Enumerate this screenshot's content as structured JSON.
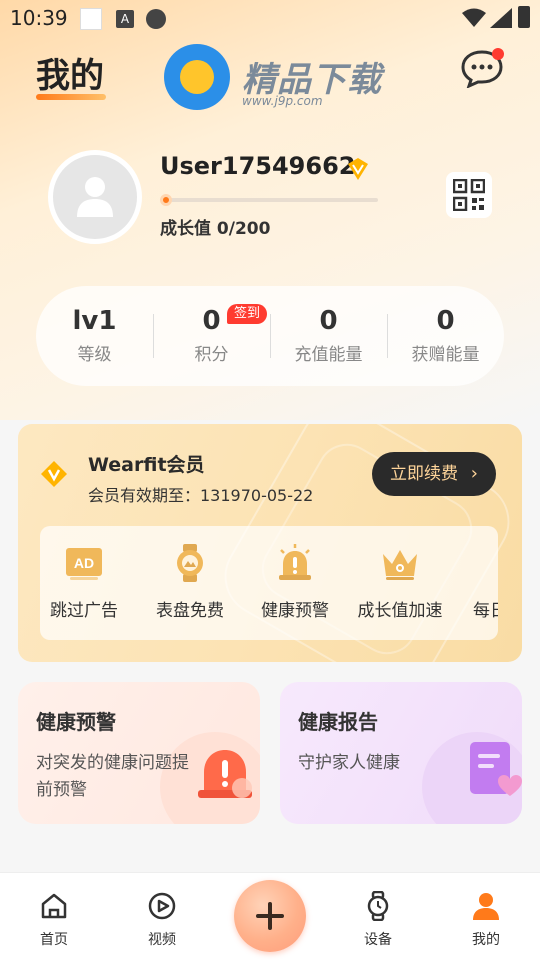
{
  "status_bar": {
    "time": "10:39",
    "a_icon": "A"
  },
  "header": {
    "title": "我的",
    "logo_text": "精品下载",
    "logo_url": "www.j9p.com"
  },
  "profile": {
    "username": "User17549662",
    "growth_label": "成长值 0/200",
    "growth_progress": 0
  },
  "stats": [
    {
      "value": "lv1",
      "label": "等级"
    },
    {
      "value": "0",
      "label": "积分"
    },
    {
      "value": "0",
      "label": "充值能量"
    },
    {
      "value": "0",
      "label": "获赠能量"
    }
  ],
  "signin_badge": "签到",
  "member": {
    "title": "Wearfit会员",
    "expiry": "会员有效期至：131970-05-22",
    "renew_label": "立即续费",
    "renew_arrow": "›",
    "benefits": [
      {
        "label": "跳过广告",
        "icon": "ad-icon",
        "icon_text": "AD"
      },
      {
        "label": "表盘免费",
        "icon": "watch-face-icon"
      },
      {
        "label": "健康预警",
        "icon": "alarm-icon"
      },
      {
        "label": "成长值加速",
        "icon": "crown-icon"
      },
      {
        "label": "每日",
        "icon": "coins-icon"
      }
    ]
  },
  "features": [
    {
      "title": "健康预警",
      "desc": "对突发的健康问题提前预警"
    },
    {
      "title": "健康报告",
      "desc": "守护家人健康"
    }
  ],
  "tabs": [
    {
      "label": "首页",
      "icon": "home-icon"
    },
    {
      "label": "视频",
      "icon": "video-icon"
    },
    {
      "label": "设备",
      "icon": "watch-icon"
    },
    {
      "label": "我的",
      "icon": "user-icon"
    }
  ],
  "colors": {
    "accent": "#ff7a1a",
    "badge": "#ff3b30",
    "renew_bg": "#2a2a2a",
    "renew_text": "#ffd59a"
  }
}
